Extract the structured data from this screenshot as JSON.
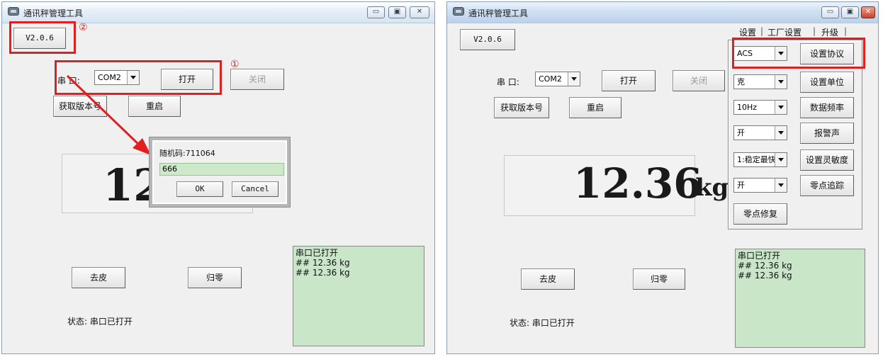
{
  "window_title": "通讯秤管理工具",
  "title_buttons": {
    "minimize": "▭",
    "maximize": "▣",
    "close": "✕"
  },
  "version_button": "V2.0.6",
  "serial": {
    "label": "串 口:",
    "port": "COM2",
    "open": "打开",
    "close": "关闭"
  },
  "get_version": "获取版本号",
  "restart": "重启",
  "weight": {
    "left_value": "12",
    "right_value": "12.36",
    "unit": "kg"
  },
  "tare": "去皮",
  "zero": "归零",
  "status": "状态: 串口已打开",
  "log": [
    "串口已打开",
    "## 12.36  kg",
    "## 12.36  kg"
  ],
  "annotations": {
    "first": "①",
    "second": "②"
  },
  "dialog": {
    "random_code": "随机码:711064",
    "input_value": "666",
    "ok": "OK",
    "cancel": "Cancel"
  },
  "tabs": [
    "设置",
    "工厂设置",
    "升级"
  ],
  "settings": {
    "protocol": {
      "value": "ACS",
      "button": "设置协议"
    },
    "unit": {
      "value": "克",
      "button": "设置单位"
    },
    "frequency": {
      "value": "10Hz",
      "button": "数据频率"
    },
    "alarm": {
      "value": "开",
      "button": "报警声"
    },
    "sensitivity": {
      "value": "1:稳定最快",
      "button": "设置灵敏度"
    },
    "zero_tracking": {
      "value": "开",
      "button": "零点追踪"
    },
    "zero_repair": "零点修复"
  },
  "colors": {
    "highlight_red": "#e02020",
    "log_bg": "#c9e6c9"
  }
}
